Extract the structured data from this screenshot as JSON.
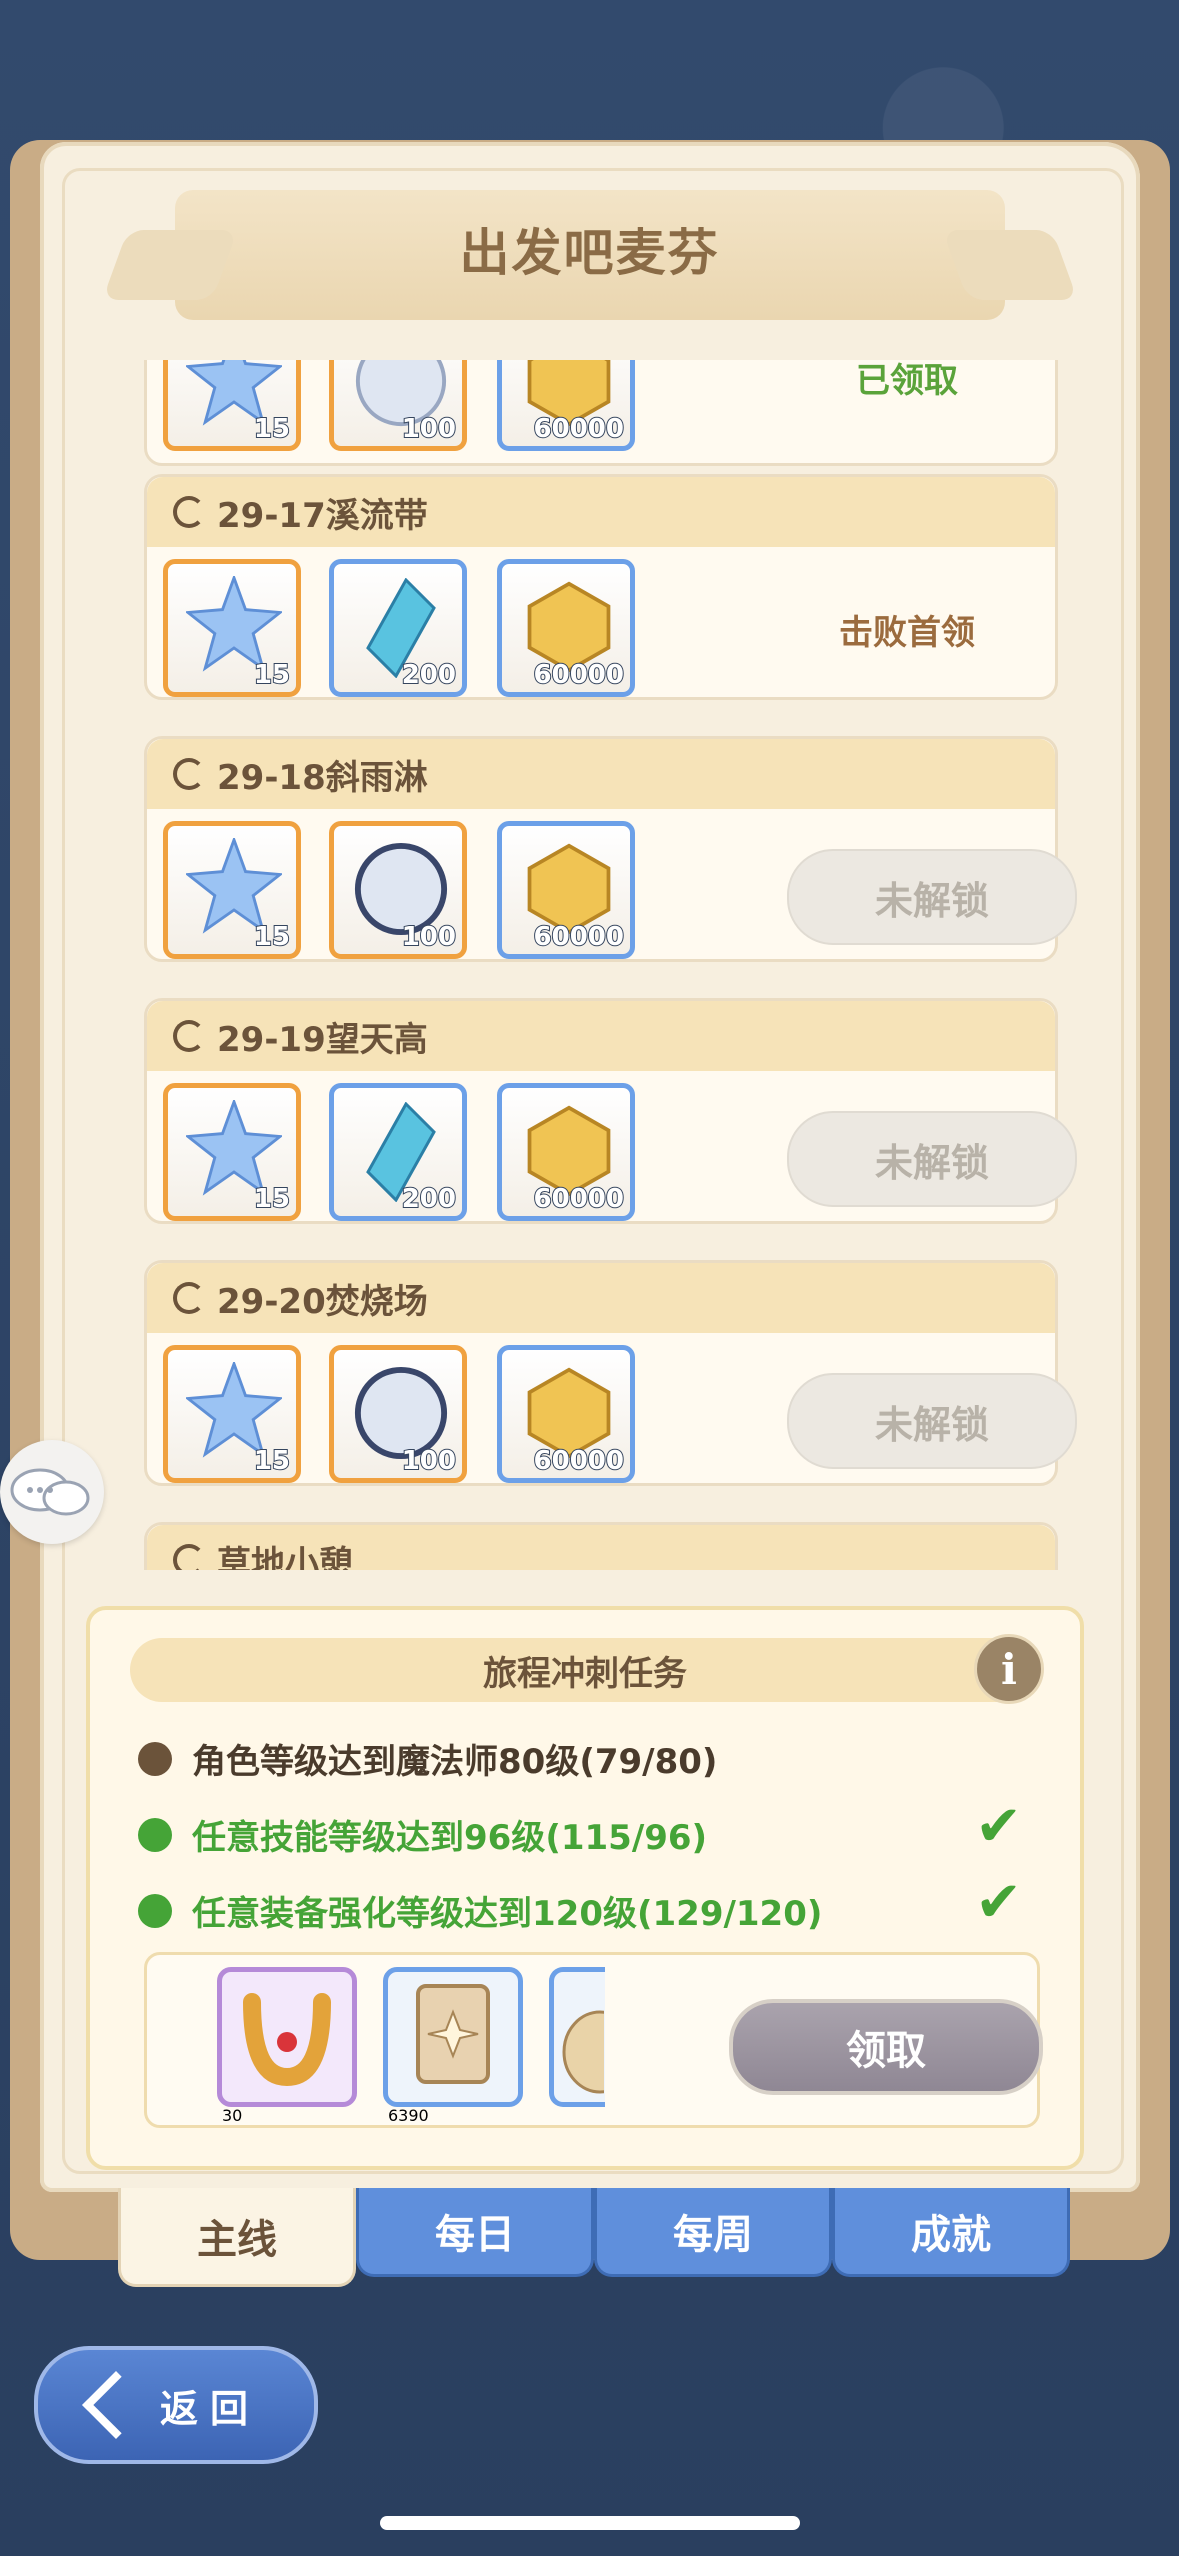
{
  "title": "出发吧麦芬",
  "top_card": {
    "counts": [
      "15",
      "100",
      "60000"
    ],
    "status": "已领取"
  },
  "stages": [
    {
      "name": "29-17溪流带",
      "counts": [
        "15",
        "200",
        "60000"
      ],
      "status": "击败首领",
      "locked": false
    },
    {
      "name": "29-18斜雨淋",
      "counts": [
        "15",
        "100",
        "60000"
      ],
      "status": "未解锁",
      "locked": true
    },
    {
      "name": "29-19望天高",
      "counts": [
        "15",
        "200",
        "60000"
      ],
      "status": "未解锁",
      "locked": true
    },
    {
      "name": "29-20焚烧场",
      "counts": [
        "15",
        "100",
        "60000"
      ],
      "status": "未解锁",
      "locked": true
    }
  ],
  "next_stage_partial": "草地小憩",
  "tasks": {
    "header": "旅程冲刺任务",
    "info_icon": "i",
    "items": [
      {
        "text": "角色等级达到魔法师80级(79/80)",
        "done": false
      },
      {
        "text": "任意技能等级达到96级(115/96)",
        "done": true
      },
      {
        "text": "任意装备强化等级达到120级(129/120)",
        "done": true
      }
    ],
    "check_mark": "✔",
    "rewards": [
      "30",
      "6390"
    ],
    "claim_label": "领取"
  },
  "tabs": [
    "主线",
    "每日",
    "每周",
    "成就"
  ],
  "back_label": "返回",
  "colors": {
    "accent_blue": "#5f8fdc",
    "done_green": "#45a437",
    "title_brown": "#8a6b46"
  }
}
